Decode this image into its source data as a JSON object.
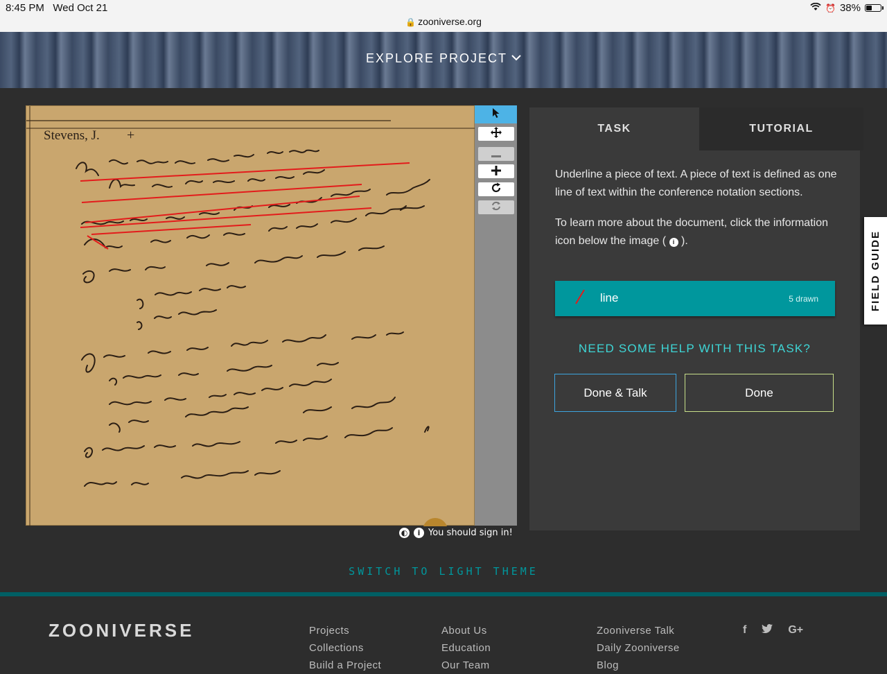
{
  "status_bar": {
    "time": "8:45 PM",
    "date": "Wed Oct 21",
    "url": "zooniverse.org",
    "battery": "38%"
  },
  "hero": {
    "explore_label": "EXPLORE PROJECT"
  },
  "toolbar": {
    "tools": [
      "pointer-icon",
      "move-icon",
      "zoom-out-icon",
      "zoom-in-icon",
      "rotate-icon",
      "reset-icon"
    ]
  },
  "subject": {
    "printed_name": "Stevens, J.",
    "annotation_color": "#e31b1b",
    "sign_in_notice": "You should sign in!"
  },
  "task_panel": {
    "tabs": {
      "task": "TASK",
      "tutorial": "TUTORIAL"
    },
    "instructions": {
      "p1": "Underline a piece of text. A piece of text is defined as one line of text within the conference notation sections.",
      "p2_prefix": "To learn more about the document, click the information icon below the image (",
      "p2_suffix": ")."
    },
    "tool": {
      "label": "line",
      "count": "5 drawn",
      "color": "#00979d"
    },
    "help_link": "NEED SOME HELP WITH THIS TASK?",
    "buttons": {
      "done_talk": "Done & Talk",
      "done": "Done"
    }
  },
  "field_guide": "FIELD GUIDE",
  "theme_switch": "SWITCH TO LIGHT THEME",
  "footer": {
    "logo": "ZOONIVERSE",
    "col1": [
      "Projects",
      "Collections",
      "Build a Project"
    ],
    "col2": [
      "About Us",
      "Education",
      "Our Team"
    ],
    "col3": [
      "Zooniverse Talk",
      "Daily Zooniverse",
      "Blog"
    ],
    "social": [
      "f",
      "t",
      "G+"
    ]
  }
}
